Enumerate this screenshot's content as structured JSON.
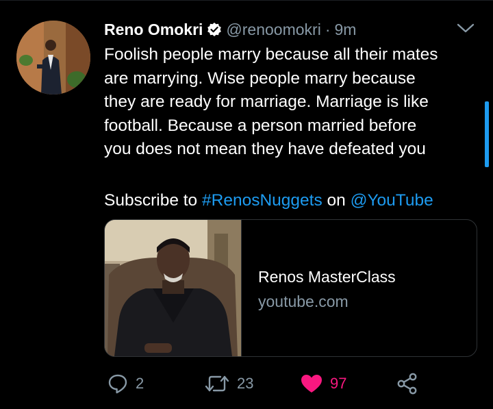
{
  "tweet": {
    "author_name": "Reno Omokri",
    "handle": "@renoomokri",
    "separator": "·",
    "time": "9m",
    "text_lines": [
      "Foolish people marry because all their mates",
      "are marrying. Wise people marry because",
      "they are ready for marriage. Marriage is like",
      "football. Because a person  married before",
      "you does not mean they have defeated you"
    ],
    "subscribe_prefix": "Subscribe to",
    "hashtag": "#RenosNuggets",
    "subscribe_middle": "on",
    "mention": "@YouTube"
  },
  "card": {
    "title": "Renos MasterClass",
    "domain": "youtube.com"
  },
  "actions": {
    "reply_count": "2",
    "retweet_count": "23",
    "like_count": "97"
  },
  "icons": {
    "verified": "verified-badge-icon",
    "caret": "chevron-down-icon",
    "reply": "reply-icon",
    "retweet": "retweet-icon",
    "like": "heart-icon",
    "share": "share-icon"
  },
  "colors": {
    "background": "#000000",
    "text": "#ffffff",
    "muted": "#8899a6",
    "link": "#1d9bf0",
    "like": "#f91880",
    "border": "#2f3336"
  }
}
